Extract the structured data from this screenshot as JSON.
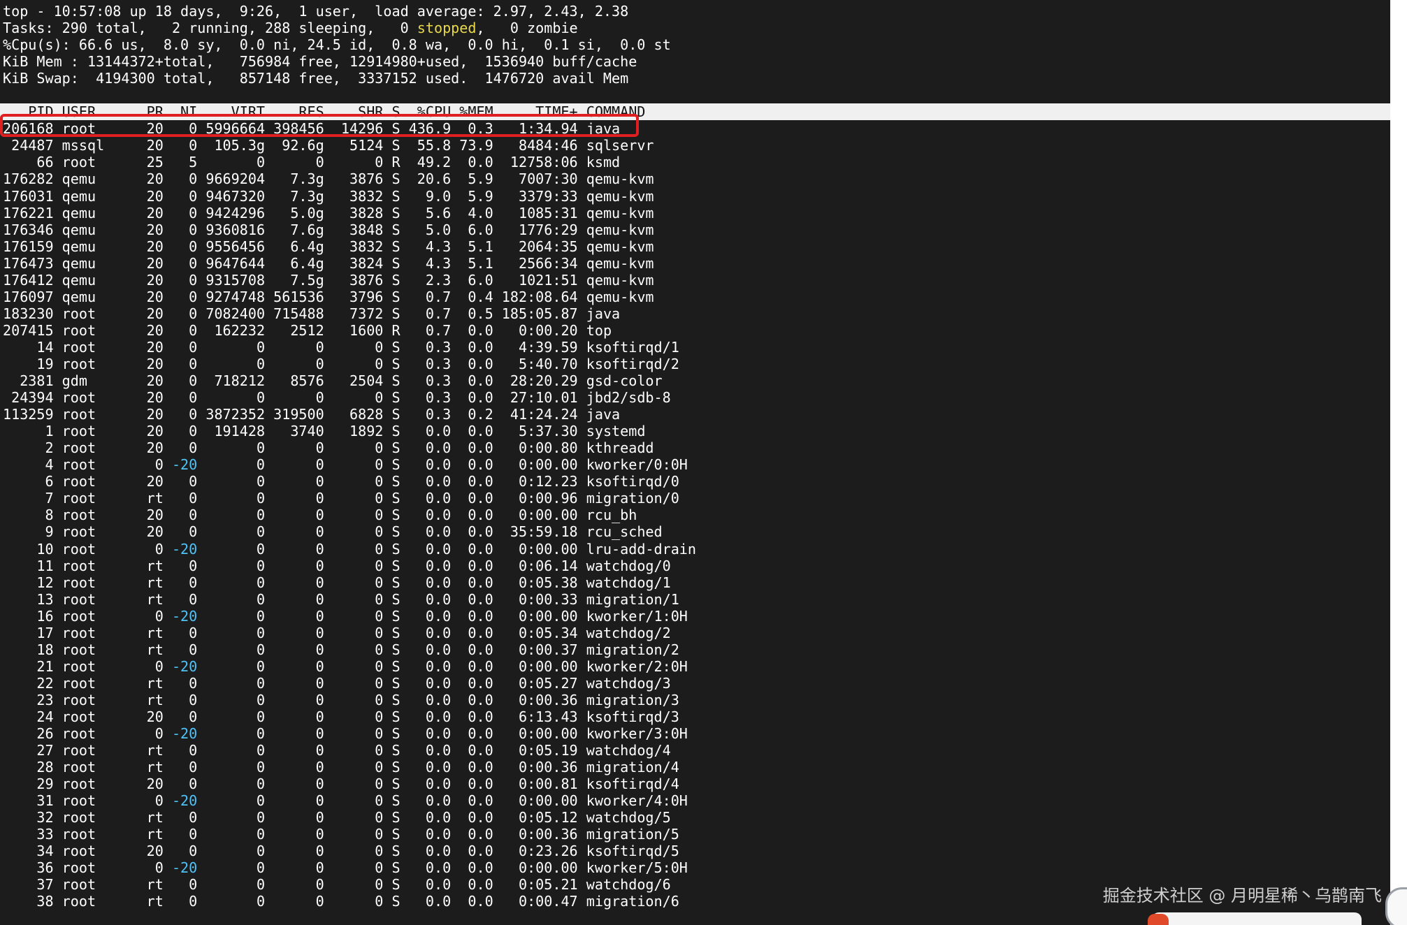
{
  "summary": {
    "line1": "top - 10:57:08 up 18 days,  9:26,  1 user,  load average: 2.97, 2.43, 2.38",
    "tasks_a": "Tasks: 290 total,   2 running, 288 sleeping,   0 ",
    "tasks_stopped": "stopped",
    "tasks_b": ",   0 zombie",
    "cpu": "%Cpu(s): 66.6 us,  8.0 sy,  0.0 ni, 24.5 id,  0.8 wa,  0.0 hi,  0.1 si,  0.0 st",
    "mem": "KiB Mem : 13144372+total,   756984 free, 12914980+used,  1536940 buff/cache",
    "swap": "KiB Swap:  4194300 total,   857148 free,  3337152 used.  1476720 avail Mem"
  },
  "table": {
    "header": "   PID USER      PR  NI    VIRT    RES    SHR S  %CPU %MEM     TIME+ COMMAND",
    "rows": [
      {
        "pre": "206168 root      20   ",
        "ni": "0",
        "post": " 5996664 398456  14296 S 436.9  0.3   1:34.94 java"
      },
      {
        "pre": " 24487 mssql     20   ",
        "ni": "0",
        "post": "  105.3g  92.6g   5124 S  55.8 73.9   8484:46 sqlservr"
      },
      {
        "pre": "    66 root      25   ",
        "ni": "5",
        "post": "       0      0      0 R  49.2  0.0  12758:06 ksmd"
      },
      {
        "pre": "176282 qemu      20   ",
        "ni": "0",
        "post": " 9669204   7.3g   3876 S  20.6  5.9   7007:30 qemu-kvm"
      },
      {
        "pre": "176031 qemu      20   ",
        "ni": "0",
        "post": " 9467320   7.3g   3832 S   9.0  5.9   3379:33 qemu-kvm"
      },
      {
        "pre": "176221 qemu      20   ",
        "ni": "0",
        "post": " 9424296   5.0g   3828 S   5.6  4.0   1085:31 qemu-kvm"
      },
      {
        "pre": "176346 qemu      20   ",
        "ni": "0",
        "post": " 9360816   7.6g   3848 S   5.0  6.0   1776:29 qemu-kvm"
      },
      {
        "pre": "176159 qemu      20   ",
        "ni": "0",
        "post": " 9556456   6.4g   3832 S   4.3  5.1   2064:35 qemu-kvm"
      },
      {
        "pre": "176473 qemu      20   ",
        "ni": "0",
        "post": " 9647644   6.4g   3824 S   4.3  5.1   2566:34 qemu-kvm"
      },
      {
        "pre": "176412 qemu      20   ",
        "ni": "0",
        "post": " 9315708   7.5g   3876 S   2.3  6.0   1021:51 qemu-kvm"
      },
      {
        "pre": "176097 qemu      20   ",
        "ni": "0",
        "post": " 9274748 561536   3796 S   0.7  0.4 182:08.64 qemu-kvm"
      },
      {
        "pre": "183230 root      20   ",
        "ni": "0",
        "post": " 7082400 715488   7372 S   0.7  0.5 185:05.87 java"
      },
      {
        "pre": "207415 root      20   ",
        "ni": "0",
        "post": "  162232   2512   1600 R   0.7  0.0   0:00.20 top"
      },
      {
        "pre": "    14 root      20   ",
        "ni": "0",
        "post": "       0      0      0 S   0.3  0.0   4:39.59 ksoftirqd/1"
      },
      {
        "pre": "    19 root      20   ",
        "ni": "0",
        "post": "       0      0      0 S   0.3  0.0   5:40.70 ksoftirqd/2"
      },
      {
        "pre": "  2381 gdm       20   ",
        "ni": "0",
        "post": "  718212   8576   2504 S   0.3  0.0  28:20.29 gsd-color"
      },
      {
        "pre": " 24394 root      20   ",
        "ni": "0",
        "post": "       0      0      0 S   0.3  0.0  27:10.01 jbd2/sdb-8"
      },
      {
        "pre": "113259 root      20   ",
        "ni": "0",
        "post": " 3872352 319500   6828 S   0.3  0.2  41:24.24 java"
      },
      {
        "pre": "     1 root      20   ",
        "ni": "0",
        "post": "  191428   3740   1892 S   0.0  0.0   5:37.30 systemd"
      },
      {
        "pre": "     2 root      20   ",
        "ni": "0",
        "post": "       0      0      0 S   0.0  0.0   0:00.80 kthreadd"
      },
      {
        "pre": "     4 root       0 ",
        "ni": "-20",
        "post": "       0      0      0 S   0.0  0.0   0:00.00 kworker/0:0H"
      },
      {
        "pre": "     6 root      20   ",
        "ni": "0",
        "post": "       0      0      0 S   0.0  0.0   0:12.23 ksoftirqd/0"
      },
      {
        "pre": "     7 root      rt   ",
        "ni": "0",
        "post": "       0      0      0 S   0.0  0.0   0:00.96 migration/0"
      },
      {
        "pre": "     8 root      20   ",
        "ni": "0",
        "post": "       0      0      0 S   0.0  0.0   0:00.00 rcu_bh"
      },
      {
        "pre": "     9 root      20   ",
        "ni": "0",
        "post": "       0      0      0 S   0.0  0.0  35:59.18 rcu_sched"
      },
      {
        "pre": "    10 root       0 ",
        "ni": "-20",
        "post": "       0      0      0 S   0.0  0.0   0:00.00 lru-add-drain"
      },
      {
        "pre": "    11 root      rt   ",
        "ni": "0",
        "post": "       0      0      0 S   0.0  0.0   0:06.14 watchdog/0"
      },
      {
        "pre": "    12 root      rt   ",
        "ni": "0",
        "post": "       0      0      0 S   0.0  0.0   0:05.38 watchdog/1"
      },
      {
        "pre": "    13 root      rt   ",
        "ni": "0",
        "post": "       0      0      0 S   0.0  0.0   0:00.33 migration/1"
      },
      {
        "pre": "    16 root       0 ",
        "ni": "-20",
        "post": "       0      0      0 S   0.0  0.0   0:00.00 kworker/1:0H"
      },
      {
        "pre": "    17 root      rt   ",
        "ni": "0",
        "post": "       0      0      0 S   0.0  0.0   0:05.34 watchdog/2"
      },
      {
        "pre": "    18 root      rt   ",
        "ni": "0",
        "post": "       0      0      0 S   0.0  0.0   0:00.37 migration/2"
      },
      {
        "pre": "    21 root       0 ",
        "ni": "-20",
        "post": "       0      0      0 S   0.0  0.0   0:00.00 kworker/2:0H"
      },
      {
        "pre": "    22 root      rt   ",
        "ni": "0",
        "post": "       0      0      0 S   0.0  0.0   0:05.27 watchdog/3"
      },
      {
        "pre": "    23 root      rt   ",
        "ni": "0",
        "post": "       0      0      0 S   0.0  0.0   0:00.36 migration/3"
      },
      {
        "pre": "    24 root      20   ",
        "ni": "0",
        "post": "       0      0      0 S   0.0  0.0   6:13.43 ksoftirqd/3"
      },
      {
        "pre": "    26 root       0 ",
        "ni": "-20",
        "post": "       0      0      0 S   0.0  0.0   0:00.00 kworker/3:0H"
      },
      {
        "pre": "    27 root      rt   ",
        "ni": "0",
        "post": "       0      0      0 S   0.0  0.0   0:05.19 watchdog/4"
      },
      {
        "pre": "    28 root      rt   ",
        "ni": "0",
        "post": "       0      0      0 S   0.0  0.0   0:00.36 migration/4"
      },
      {
        "pre": "    29 root      20   ",
        "ni": "0",
        "post": "       0      0      0 S   0.0  0.0   0:00.81 ksoftirqd/4"
      },
      {
        "pre": "    31 root       0 ",
        "ni": "-20",
        "post": "       0      0      0 S   0.0  0.0   0:00.00 kworker/4:0H"
      },
      {
        "pre": "    32 root      rt   ",
        "ni": "0",
        "post": "       0      0      0 S   0.0  0.0   0:05.12 watchdog/5"
      },
      {
        "pre": "    33 root      rt   ",
        "ni": "0",
        "post": "       0      0      0 S   0.0  0.0   0:00.36 migration/5"
      },
      {
        "pre": "    34 root      20   ",
        "ni": "0",
        "post": "       0      0      0 S   0.0  0.0   0:23.26 ksoftirqd/5"
      },
      {
        "pre": "    36 root       0 ",
        "ni": "-20",
        "post": "       0      0      0 S   0.0  0.0   0:00.00 kworker/5:0H"
      },
      {
        "pre": "    37 root      rt   ",
        "ni": "0",
        "post": "       0      0      0 S   0.0  0.0   0:05.21 watchdog/6"
      },
      {
        "pre": "    38 root      rt   ",
        "ni": "0",
        "post": "       0      0      0 S   0.0  0.0   0:00.47 migration/6"
      }
    ]
  },
  "watermark": "掘金技术社区 @ 月明星稀丶乌鹊南飞",
  "colors": {
    "background": "#1c1c1c",
    "text": "#ffffff",
    "header_bg": "#f0f0f0",
    "stopped": "#e8d84a",
    "negative_nice": "#4fc3f7",
    "highlight_border": "#e02020"
  }
}
